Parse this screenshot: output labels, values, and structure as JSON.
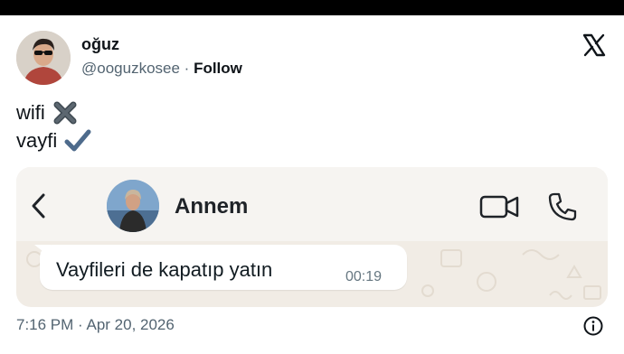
{
  "author": {
    "name": "oğuz",
    "handle": "@ooguzkosee",
    "separator": " · ",
    "follow_label": "Follow",
    "avatar_icon": "profile-photo"
  },
  "platform_icon": "x-logo",
  "tweet": {
    "line1": "wifi",
    "line1_emoji": "cross-mark",
    "line2": "vayfi",
    "line2_emoji": "check-mark"
  },
  "chat": {
    "contact_name": "Annem",
    "message_text": "Vayfileri de kapatıp yatın",
    "message_time": "00:19",
    "icons": [
      "back-chevron",
      "video-call",
      "phone-call"
    ]
  },
  "footer": {
    "timestamp": "7:16 PM · Apr 20, 2026",
    "info_icon": "info-circle"
  },
  "colors": {
    "text_primary": "#0f1419",
    "text_secondary": "#536471",
    "chat_background": "#f1ece5",
    "bubble": "#ffffff",
    "check_mark": "#4e6b8c"
  }
}
